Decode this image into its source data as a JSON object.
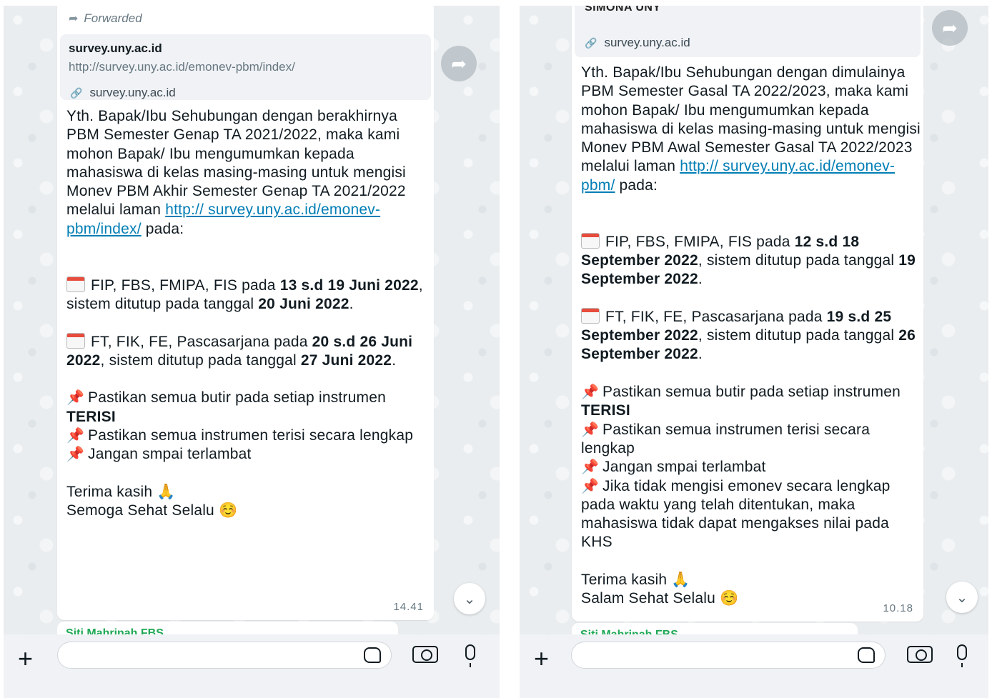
{
  "left": {
    "forwarded_label": "Forwarded",
    "preview": {
      "title": "survey.uny.ac.id",
      "url": "http://survey.uny.ac.id/emonev-pbm/index/",
      "domain": "survey.uny.ac.id"
    },
    "message": {
      "intro": "Yth. Bapak/Ibu Sehubungan dengan berakhirnya PBM Semester Genap TA 2021/2022, maka kami mohon Bapak/ Ibu mengumumkan kepada mahasiswa di kelas masing-masing untuk mengisi Monev PBM Akhir Semester Genap TA 2021/2022 melalui laman ",
      "link": "http:// survey.uny.ac.id/emonev-pbm/index/",
      "intro_end": " pada:",
      "sched1_a": "FIP, FBS, FMIPA, FIS pada ",
      "sched1_b": "13 s.d 19 Juni 2022",
      "sched1_c": ", sistem ditutup pada tanggal ",
      "sched1_d": "20 Juni 2022",
      "sched1_e": ".",
      "sched2_a": "FT, FIK, FE, Pascasarjana pada ",
      "sched2_b": "20 s.d 26 Juni 2022",
      "sched2_c": ", sistem ditutup pada tanggal ",
      "sched2_d": "27 Juni 2022",
      "sched2_e": ".",
      "pin1_a": "Pastikan semua butir pada setiap instrumen ",
      "pin1_b": "TERISI",
      "pin2": "Pastikan semua instrumen terisi secara lengkap",
      "pin3": "Jangan smpai terlambat",
      "thanks": "Terima kasih",
      "closing": "Semoga Sehat Selalu"
    },
    "time": "14.41",
    "next_sender": "Siti Mahrinah FBS"
  },
  "right": {
    "sender": "SiMONA UNY",
    "preview": {
      "domain": "survey.uny.ac.id"
    },
    "message": {
      "intro": "Yth. Bapak/Ibu Sehubungan dengan dimulainya PBM Semester Gasal TA 2022/2023, maka kami mohon Bapak/ Ibu mengumumkan kepada mahasiswa di kelas masing-masing untuk mengisi Monev PBM Awal Semester Gasal TA 2022/2023 melalui laman ",
      "link": "http:// survey.uny.ac.id/emonev-pbm/",
      "intro_end": " pada:",
      "sched1_a": "FIP, FBS, FMIPA, FIS pada ",
      "sched1_b": "12 s.d 18 September 2022",
      "sched1_c": ", sistem ditutup pada tanggal ",
      "sched1_d": "19 September 2022",
      "sched1_e": ".",
      "sched2_a": "FT, FIK, FE, Pascasarjana pada ",
      "sched2_b": "19 s.d 25 September 2022",
      "sched2_c": ", sistem ditutup pada tanggal ",
      "sched2_d": "26 September 2022",
      "sched2_e": ".",
      "pin1_a": "Pastikan semua butir pada setiap instrumen ",
      "pin1_b": "TERISI",
      "pin2": "Pastikan semua instrumen terisi secara lengkap",
      "pin3": "Jangan smpai terlambat",
      "pin4": "Jika tidak mengisi emonev secara lengkap pada waktu yang telah ditentukan, maka mahasiswa tidak dapat mengakses nilai pada KHS",
      "thanks": "Terima kasih",
      "closing": "Salam Sehat Selalu"
    },
    "time": "10.18",
    "next_sender": "Siti Mahrinah FBS"
  },
  "icons": {
    "forwarded": "forward-arrow-icon",
    "link": "link-icon",
    "calendar": "calendar-emoji",
    "pin": "pushpin-emoji",
    "pray": "folded-hands-emoji",
    "smile": "smiling-face-emoji",
    "share": "share-forward-icon",
    "scroll": "chevron-down-icon",
    "plus": "plus-icon",
    "sticker": "sticker-icon",
    "camera": "camera-icon",
    "mic": "microphone-icon"
  },
  "colors": {
    "link": "#027eb5",
    "bubble": "#ffffff",
    "wallpaper": "#e9edef",
    "sender_peek": "#1fa855"
  }
}
